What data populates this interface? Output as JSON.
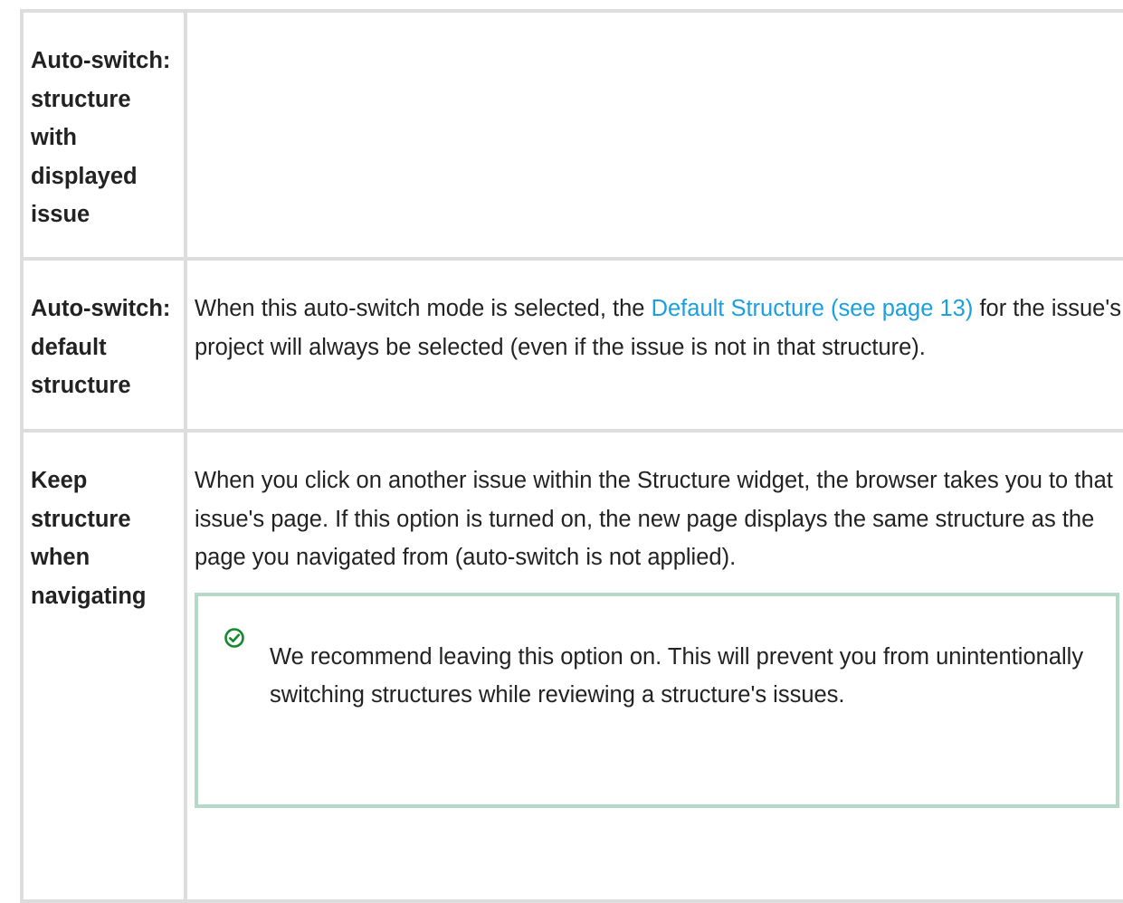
{
  "rows": [
    {
      "name": "Auto-switch: structure with displayed issue",
      "description": ""
    },
    {
      "name": "Auto-switch: default structure",
      "description_before": "When this auto-switch mode is selected, the ",
      "link_text": "Default Structure (see page 13)",
      "description_after": " for the issue's project will always be selected (even if the issue is not in that structure)."
    },
    {
      "name": "Keep structure when navigating",
      "description": "When you click on another issue within the Structure widget, the browser takes you to that issue's page. If this option is turned on, the new page displays the same structure as the page you navigated from (auto-switch is not applied).",
      "tip": {
        "icon": "check-circle-icon",
        "text": "We recommend leaving this option on. This will prevent you from unintentionally switching structures while reviewing a structure's issues."
      }
    }
  ],
  "colors": {
    "border": "#dddddd",
    "link": "#1a9fe0",
    "tip_border": "#b5d9c8",
    "tip_icon": "#14892c"
  }
}
